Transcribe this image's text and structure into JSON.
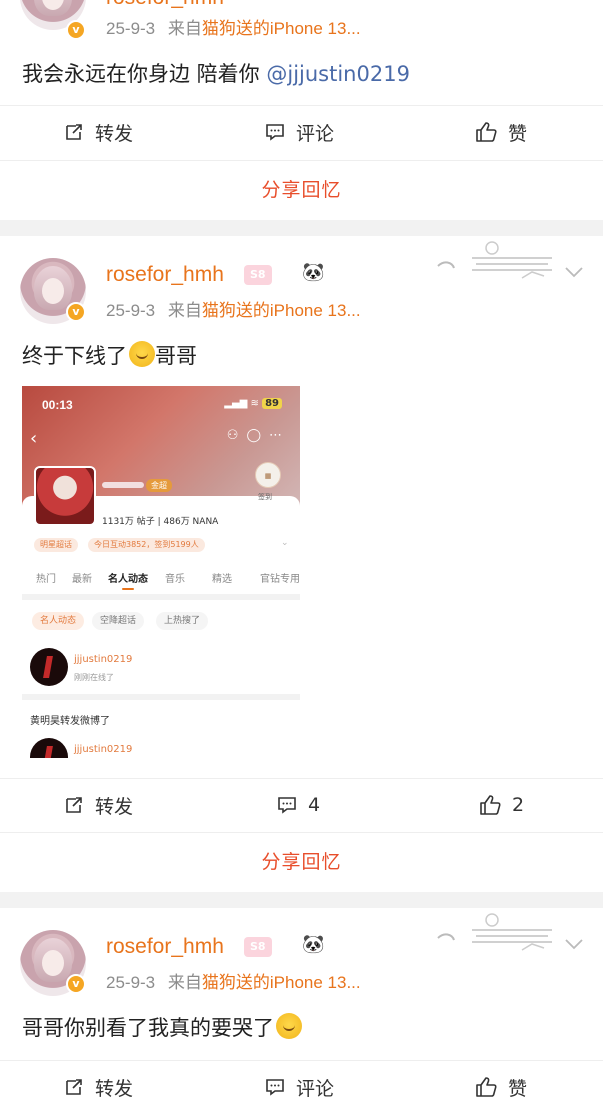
{
  "colors": {
    "accent": "#e8741c",
    "share": "#e84e2b",
    "mention": "#4a6aa8",
    "meta": "#8c8c8c",
    "divider": "#f2f2f2"
  },
  "posts": [
    {
      "username": "rosefor_hmh",
      "level": "S8",
      "date": "25-9-3",
      "from_prefix": "来自",
      "source": "猫狗送的iPhone 13...",
      "text": "我会永远在你身边 陪着你 ",
      "mention": "@jjjustin0219",
      "actions": {
        "repost": "转发",
        "comment": "评论",
        "like": "赞"
      },
      "share": "分享回忆"
    },
    {
      "username": "rosefor_hmh",
      "level": "S8",
      "date": "25-9-3",
      "from_prefix": "来自",
      "source": "猫狗送的iPhone 13...",
      "text": "终于下线了",
      "text_after": "哥哥",
      "actions": {
        "repost": "转发",
        "comment": "4",
        "like": "2"
      },
      "share": "分享回忆",
      "screenshot": {
        "time": "00:13",
        "battery": "89",
        "badge": "金超",
        "signin": "签到",
        "counts": "1131万 帖子 | 486万 NANA",
        "pills": [
          "明星超话",
          "今日互动3852，签到5199人"
        ],
        "tabs": [
          "热门",
          "最新",
          "名人动态",
          "音乐",
          "精选",
          "官钻专用"
        ],
        "active_tab": "名人动态",
        "chips": [
          "名人动态",
          "空降超话",
          "上热搜了"
        ],
        "user1": "jjjustin0219",
        "user1_status": "刚刚在线了",
        "repost_line": "黄明昊转发微博了",
        "user2": "jjjustin0219"
      }
    },
    {
      "username": "rosefor_hmh",
      "level": "S8",
      "date": "25-9-3",
      "from_prefix": "来自",
      "source": "猫狗送的iPhone 13...",
      "text": "哥哥你别看了我真的要哭了",
      "actions": {
        "repost": "转发",
        "comment": "评论",
        "like": "赞"
      }
    }
  ]
}
